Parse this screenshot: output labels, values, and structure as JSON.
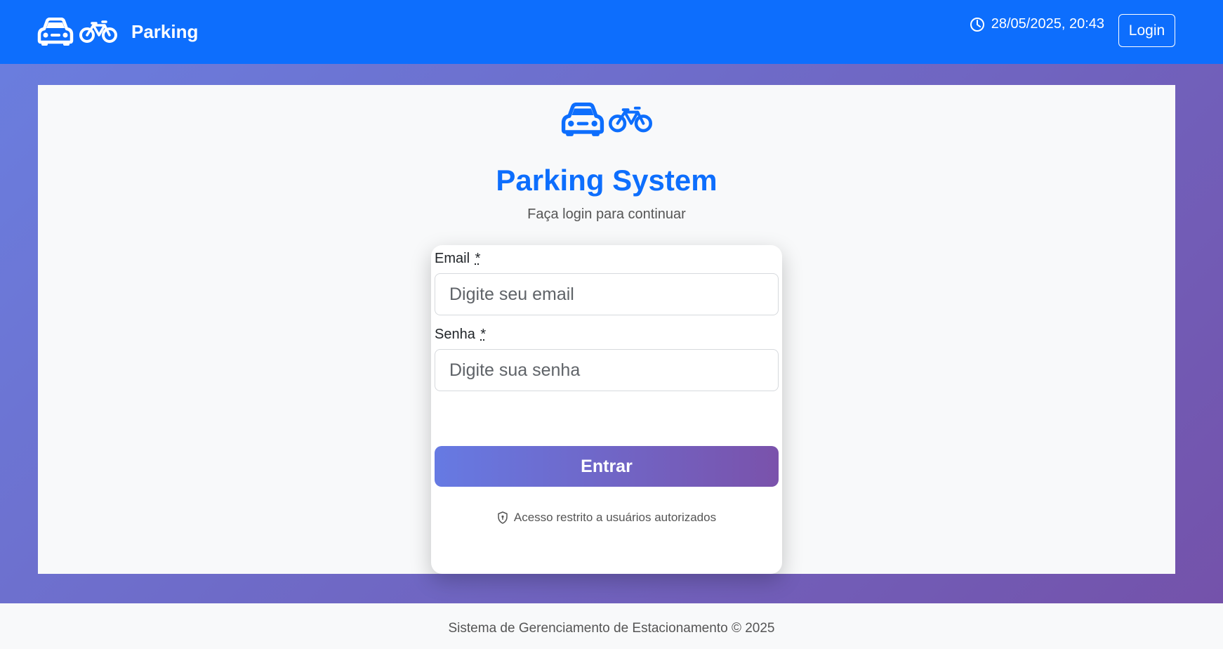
{
  "navbar": {
    "brand": "Parking",
    "datetime": "28/05/2025, 20:43",
    "login_label": "Login",
    "icons": [
      "car-icon",
      "bicycle-icon",
      "clock-icon"
    ],
    "color": "#0d6efd"
  },
  "hero": {
    "title": "Parking System",
    "subtitle": "Faça login para continuar",
    "icons": [
      "car-icon",
      "bicycle-icon"
    ]
  },
  "form": {
    "email": {
      "label": "Email",
      "required_mark": "*",
      "placeholder": "Digite seu email",
      "value": ""
    },
    "password": {
      "label": "Senha",
      "required_mark": "*",
      "placeholder": "Digite sua senha",
      "value": ""
    },
    "submit_label": "Entrar",
    "notice": "Acesso restrito a usuários autorizados",
    "notice_icon": "shield-icon"
  },
  "footer": {
    "text": "Sistema de Gerenciamento de Estacionamento © 2025"
  }
}
